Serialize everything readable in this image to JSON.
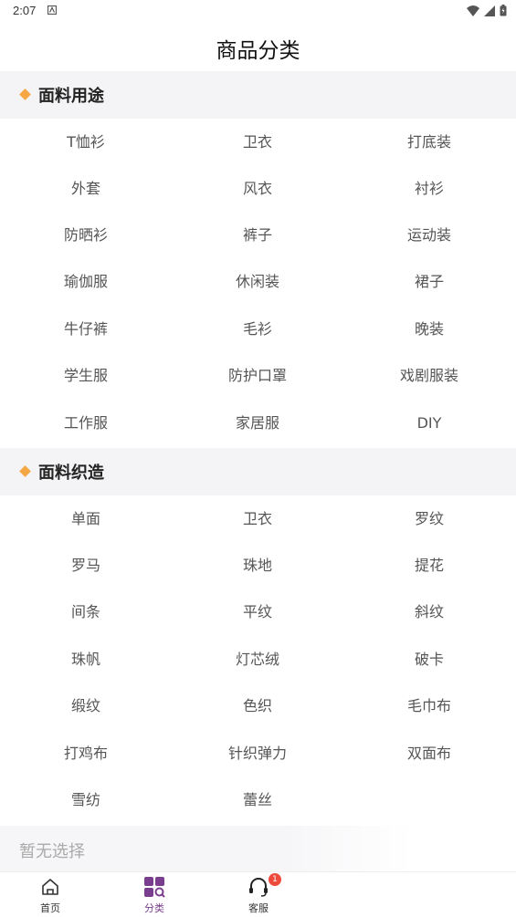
{
  "status_bar": {
    "time": "2:07"
  },
  "header": {
    "title": "商品分类"
  },
  "sections": [
    {
      "title": "面料用途",
      "items": [
        "T恤衫",
        "卫衣",
        "打底装",
        "外套",
        "风衣",
        "衬衫",
        "防晒衫",
        "裤子",
        "运动装",
        "瑜伽服",
        "休闲装",
        "裙子",
        "牛仔裤",
        "毛衫",
        "晚装",
        "学生服",
        "防护口罩",
        "戏剧服装",
        "工作服",
        "家居服",
        "DIY"
      ]
    },
    {
      "title": "面料织造",
      "items": [
        "单面",
        "卫衣",
        "罗纹",
        "罗马",
        "珠地",
        "提花",
        "间条",
        "平纹",
        "斜纹",
        "珠帆",
        "灯芯绒",
        "破卡",
        "缎纹",
        "色织",
        "毛巾布",
        "打鸡布",
        "针织弹力",
        "双面布",
        "雪纺",
        "蕾丝"
      ]
    }
  ],
  "selection": {
    "placeholder": "暂无选择"
  },
  "tabbar": {
    "tabs": [
      {
        "label": "首页",
        "icon": "home-icon",
        "active": false
      },
      {
        "label": "分类",
        "icon": "category-icon",
        "active": true
      },
      {
        "label": "客服",
        "icon": "headset-icon",
        "active": false,
        "badge": "1"
      }
    ]
  },
  "colors": {
    "accent": "#f5a645",
    "active_tab": "#7a3e8e",
    "badge": "#ef4b3d"
  }
}
